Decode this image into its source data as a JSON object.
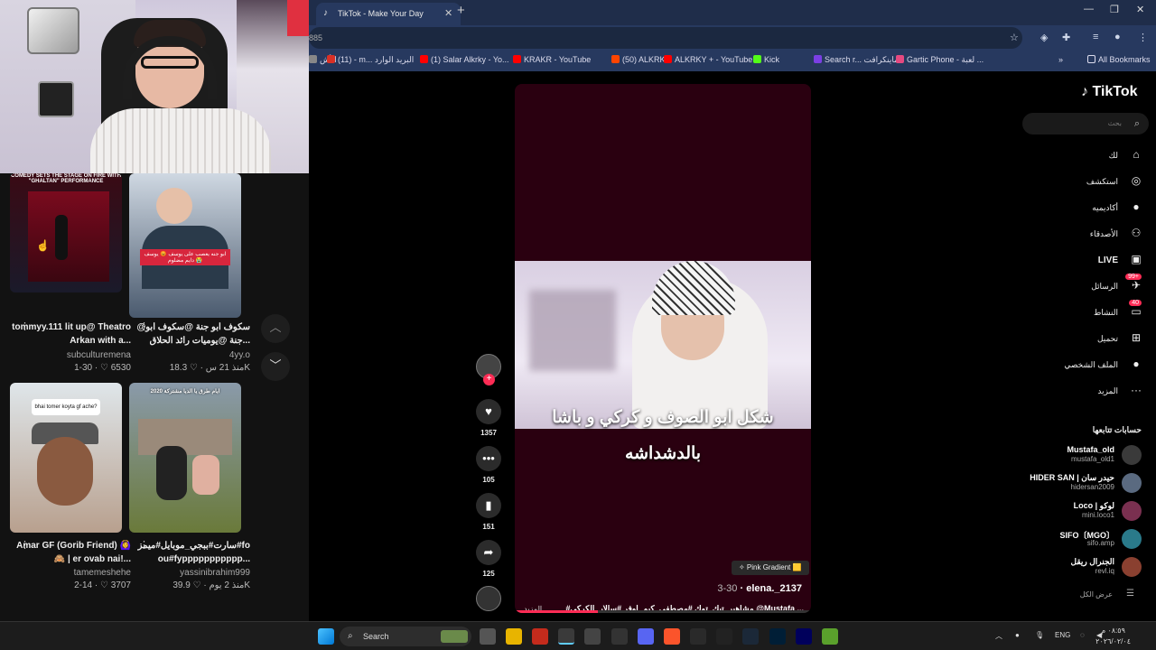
{
  "browser": {
    "tab_title": "TikTok - Make Your Day",
    "new_tab": "+",
    "url": "885",
    "bookmarks": [
      {
        "label": "الأش",
        "color": "#888888"
      },
      {
        "label": "(11) - m... البريد الوارد",
        "color": "#d93025"
      },
      {
        "label": "(1) Salar Alkrky - Yo...",
        "color": "#ff0000"
      },
      {
        "label": "KRAKR - YouTube",
        "color": "#ff0000"
      },
      {
        "label": "(50) ALKRKY",
        "color": "#ff4500"
      },
      {
        "label": "ALKRKY + - YouTube",
        "color": "#ff0000"
      },
      {
        "label": "Kick",
        "color": "#53fc18"
      },
      {
        "label": "Search r... ماينكرافت",
        "color": "#7b3fe4"
      },
      {
        "label": "Gartic Phone - لعبة ...",
        "color": "#e64980"
      }
    ],
    "all_bookmarks": "All Bookmarks",
    "more_bookmarks": "»"
  },
  "tiktok": {
    "logo": "TikTok",
    "search_placeholder": "بحث",
    "nav": [
      {
        "label": "لك",
        "icon": "home-icon",
        "glyph": "⌂"
      },
      {
        "label": "استكشف",
        "icon": "compass-icon",
        "glyph": "◎"
      },
      {
        "label": "أكاديميه",
        "icon": "avatar-icon",
        "glyph": "●"
      },
      {
        "label": "الأصدقاء",
        "icon": "friends-icon",
        "glyph": "⚇"
      },
      {
        "label": "LIVE",
        "icon": "live-icon",
        "glyph": "▣"
      },
      {
        "label": "الرسائل",
        "icon": "messages-icon",
        "glyph": "✈",
        "badge": "99+"
      },
      {
        "label": "النشاط",
        "icon": "activity-icon",
        "glyph": "▭",
        "badge": "40"
      },
      {
        "label": "تحميل",
        "icon": "upload-icon",
        "glyph": "⊞"
      },
      {
        "label": "الملف الشخصي",
        "icon": "profile-icon",
        "glyph": "●"
      },
      {
        "label": "المزيد",
        "icon": "more-icon",
        "glyph": "···"
      }
    ],
    "following_header": "حسابات تتابعها",
    "following": [
      {
        "name": "Mustafa_old",
        "handle": "mustafa_old1",
        "color": "#3a3a3a"
      },
      {
        "name": "HIDER SAN | حيدر سان",
        "handle": "hidersan2009",
        "color": "#5a6a80"
      },
      {
        "name": "Loco | لوكو",
        "handle": "mini.loco1",
        "color": "#7a3050"
      },
      {
        "name": "SIFO〔MGO〕",
        "handle": "sifo.amp",
        "color": "#2a7a8a"
      },
      {
        "name": "الجنرال ريقل",
        "handle": "revl.iq",
        "color": "#8a4030"
      }
    ],
    "show_all": "عرض الكل",
    "video": {
      "overlay_line1": "شكل ابو الصوف و كركي و باشا",
      "overlay_line2": "بالدشداشه",
      "effect_badge": "✧ Pink Gradient 🟨",
      "author": "elena._2137",
      "date": "3-30",
      "caption": "#مشاهير_تيك_توك #مصطفى_كيم_اوفر #سالار_الكركي @Mustafa ...",
      "more": "المزيد",
      "progress": 0.28,
      "likes": "1357",
      "comments": "105",
      "saves": "151",
      "shares": "125"
    },
    "grid": [
      {
        "caption": "tommyy.111 lit up@ Theatro Arkan with a...",
        "author": "subculturemena",
        "views": "6530",
        "date": "1-30",
        "thumb_top": "#2a0a12",
        "thumb_bottom": "#1a1a2a",
        "overlay": "COMEDY SETS THE STAGE ON FIRE WITH \"GHALTAN\" PERFORMANCE"
      },
      {
        "caption": "@سكوف ابو جنة @سكوف ابو جنة @يوميات رائد الحلاق...",
        "author": "4yy.o",
        "views": "18.3K",
        "date": "منذ 21 س",
        "thumb_top": "#dfe6ef",
        "thumb_bottom": "#3a4a5e",
        "overlay": "ابو جنه يعصب على يوسف 😡 يوسف دايم مضلوم 😭"
      },
      {
        "caption": "Amar GF (Gorib Friend) 🙆‍♀️🙈 | er ovab nai!...",
        "author": "tamemeshehe",
        "views": "3707",
        "date": "2-14",
        "thumb_top": "#cfd8dc",
        "thumb_bottom": "#a08a7a",
        "overlay": "bhai tomer koyta gf ache?"
      },
      {
        "caption": "سارت#ببجي_موبايل#ميمز#fo ou#fyppppppppppp...",
        "author": "yassinibrahim999",
        "views": "39.9K",
        "date": "منذ 2 يوم",
        "thumb_top": "#7a8a9a",
        "thumb_bottom": "#5a6a3a",
        "overlay": "2020 ايام طرق يا الديا مشتركة"
      }
    ]
  },
  "taskbar": {
    "search": "Search",
    "lang": "ENG",
    "time": "٠٨:٥٩ م",
    "date": "٢٠٢٦/٠٢/٠٤"
  }
}
